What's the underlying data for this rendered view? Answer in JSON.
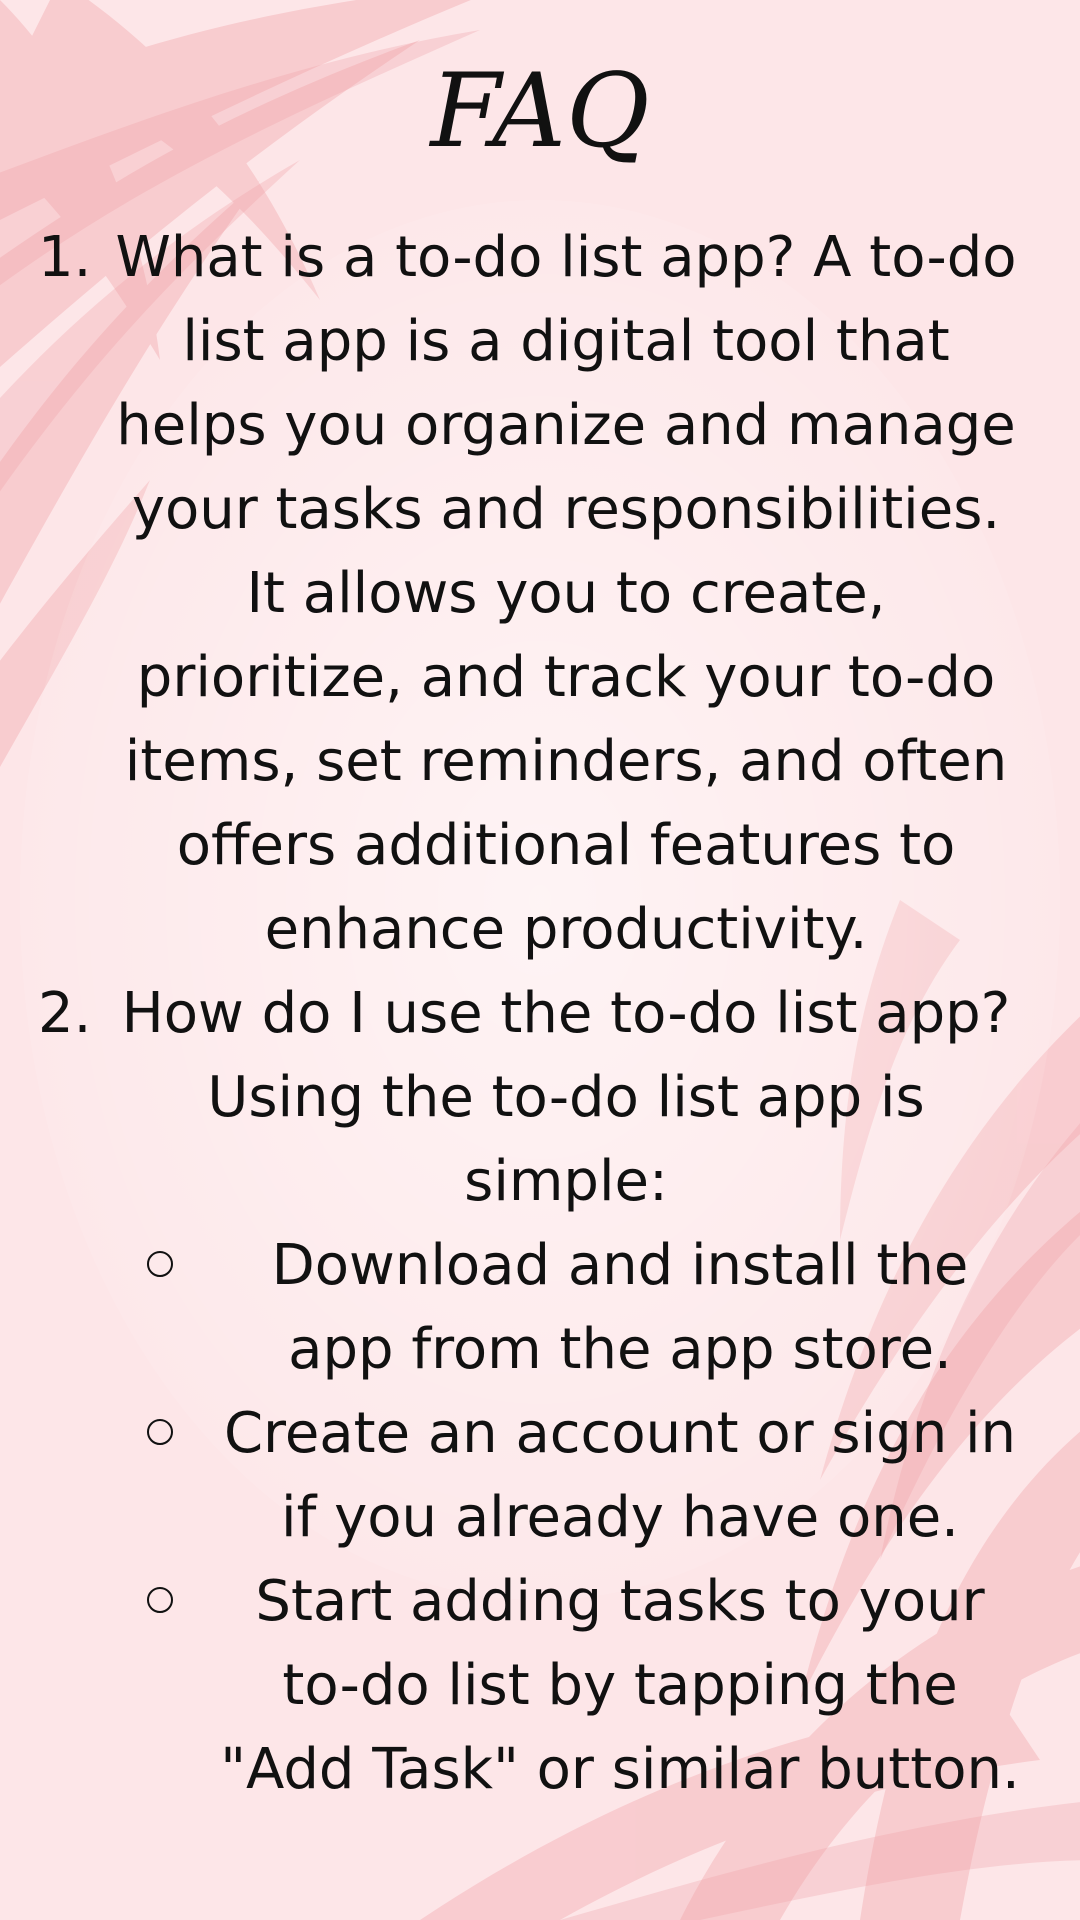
{
  "title": "FAQ",
  "items": [
    {
      "number": "1.",
      "lines": [
        "What is a to-do list app? A to-do",
        "list app is a digital tool that",
        "helps you organize and manage",
        "your tasks and responsibilities.",
        "It allows you to create,",
        "prioritize, and track your to-do",
        "items, set reminders, and often",
        "offers additional features to",
        "enhance productivity."
      ]
    },
    {
      "number": "2.",
      "lines": [
        "How do I use the to-do list app?",
        "Using the to-do list app is",
        "simple:"
      ],
      "subitems": [
        {
          "lines": [
            "Download and install the",
            "app from the app store."
          ]
        },
        {
          "lines": [
            "Create an account or sign in",
            "if you already have one."
          ]
        },
        {
          "lines": [
            "Start adding tasks to your",
            "to-do list by tapping the",
            "\"Add Task\" or similar button."
          ]
        }
      ]
    }
  ],
  "colors": {
    "background": "#fde4e6",
    "leaf": "#f2a8ad",
    "text": "#111111"
  }
}
